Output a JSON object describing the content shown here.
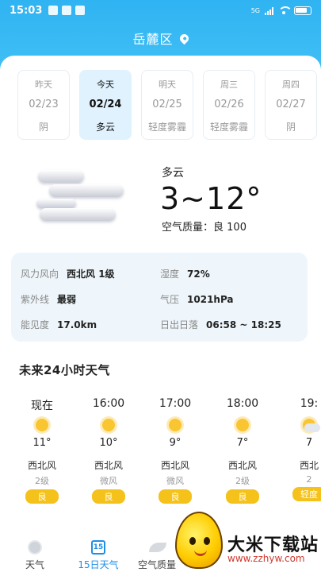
{
  "status_bar": {
    "time": "15:03",
    "network": "5G"
  },
  "location": "岳麓区",
  "days": [
    {
      "name": "昨天",
      "date": "02/23",
      "cond": "阴",
      "active": false
    },
    {
      "name": "今天",
      "date": "02/24",
      "cond": "多云",
      "active": true
    },
    {
      "name": "明天",
      "date": "02/25",
      "cond": "轻度雾霾",
      "active": false
    },
    {
      "name": "周三",
      "date": "02/26",
      "cond": "轻度雾霾",
      "active": false
    },
    {
      "name": "周四",
      "date": "02/27",
      "cond": "阴",
      "active": false
    }
  ],
  "current": {
    "condition": "多云",
    "temp_range": "3~12°",
    "air_quality_label": "空气质量：",
    "air_quality_value": "良 100"
  },
  "details": {
    "wind_label": "风力风向",
    "wind_value": "西北风 1级",
    "humidity_label": "湿度",
    "humidity_value": "72%",
    "uv_label": "紫外线",
    "uv_value": "最弱",
    "pressure_label": "气压",
    "pressure_value": "1021hPa",
    "visibility_label": "能见度",
    "visibility_value": "17.0km",
    "sun_label": "日出日落",
    "sun_value": "06:58 ~ 18:25"
  },
  "hourly_title": "未来24小时天气",
  "hourly": [
    {
      "time": "现在",
      "temp": "11°",
      "dir": "西北风",
      "level": "2级",
      "aq": "良",
      "icon": "sun-icon"
    },
    {
      "time": "16:00",
      "temp": "10°",
      "dir": "西北风",
      "level": "微风",
      "aq": "良",
      "icon": "sun-icon"
    },
    {
      "time": "17:00",
      "temp": "9°",
      "dir": "西北风",
      "level": "微风",
      "aq": "良",
      "icon": "sun-icon"
    },
    {
      "time": "18:00",
      "temp": "7°",
      "dir": "西北风",
      "level": "2级",
      "aq": "良",
      "icon": "sun-icon"
    },
    {
      "time": "19:",
      "temp": "7",
      "dir": "西北",
      "level": "2",
      "aq": "轻度",
      "icon": "sun-cloud-icon"
    }
  ],
  "tabs": [
    {
      "label": "天气",
      "icon": "sun-icon",
      "active": false
    },
    {
      "label": "15日天气",
      "icon": "calendar-icon",
      "icon_text": "15",
      "active": true
    },
    {
      "label": "空气质量",
      "icon": "leaf-icon",
      "active": false
    }
  ],
  "watermark": {
    "name": "大米下载站",
    "url": "www.zzhyw.com"
  },
  "colors": {
    "header_blue": "#2fb3f2",
    "active_day_bg": "#dff2fd",
    "aq_badge": "#f5c21b",
    "active_tab": "#1f8fe6"
  }
}
